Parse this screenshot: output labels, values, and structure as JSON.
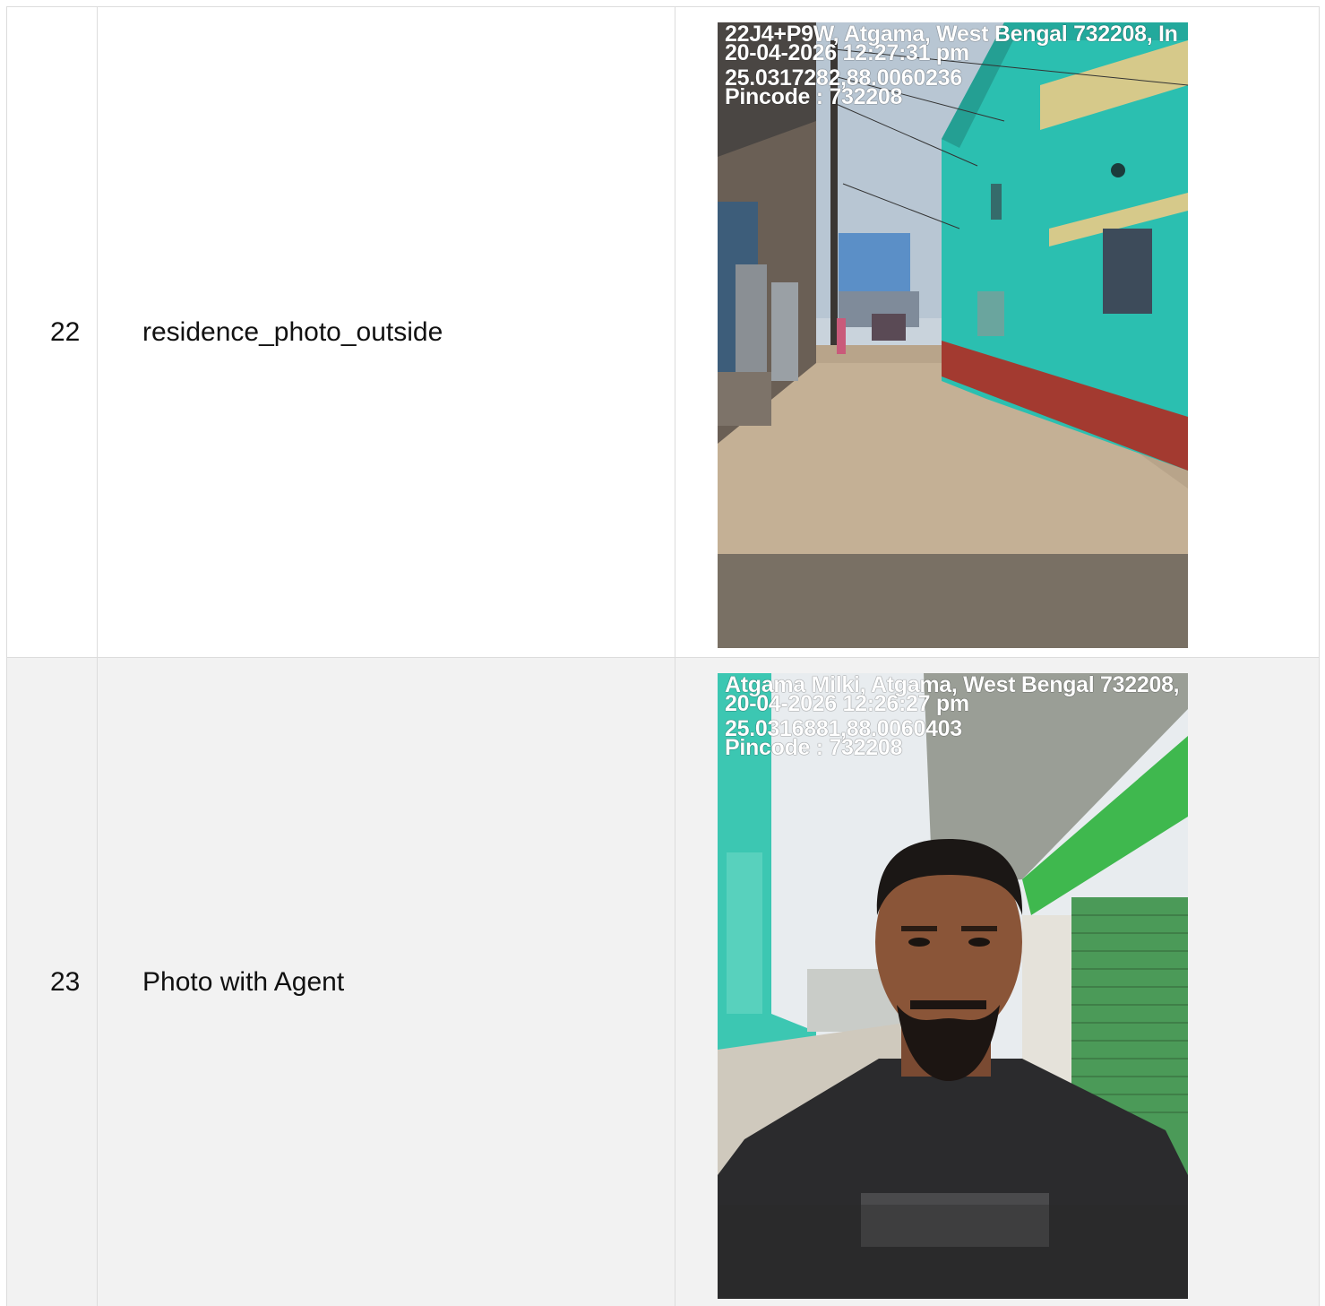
{
  "rows": [
    {
      "number": "22",
      "name": "residence_photo_outside",
      "photo": {
        "subject": "street with teal building",
        "caption": {
          "address": "22J4+P9W, Atgama, West Bengal 732208, In",
          "datetime": "20-04-2026 12:27:31 pm",
          "coordinates": "25.0317282,88.0060236",
          "pincode": "Pincode : 732208"
        }
      }
    },
    {
      "number": "23",
      "name": "Photo with Agent",
      "photo": {
        "subject": "selfie of agent on street",
        "caption": {
          "address": "Atgama Milki, Atgama, West Bengal 732208,",
          "datetime": "20-04-2026 12:26:27 pm",
          "coordinates": "25.0316881,88.0060403",
          "pincode": "Pincode : 732208"
        }
      }
    }
  ],
  "colors": {
    "row_alt_background": "#f2f2f2",
    "border": "#dcdcdc",
    "building_teal": "#2bbfb0"
  }
}
